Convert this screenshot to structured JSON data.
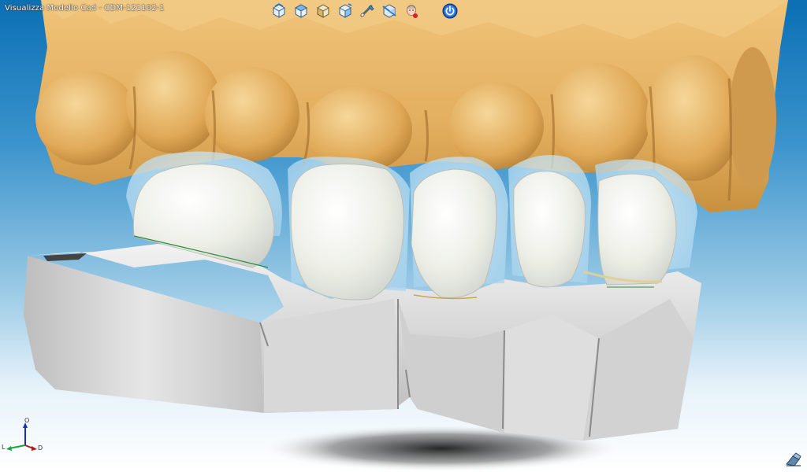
{
  "window": {
    "title": "Visualizza Modello Cad  - CDM-121102-1"
  },
  "toolbar": {
    "buttons": [
      {
        "icon": "view-front-icon"
      },
      {
        "icon": "view-top-icon"
      },
      {
        "icon": "view-left-icon"
      },
      {
        "icon": "view-right-icon"
      },
      {
        "icon": "measure-icon"
      },
      {
        "icon": "section-icon"
      },
      {
        "icon": "patient-icon"
      },
      {
        "icon": "power-icon"
      }
    ]
  },
  "axes": {
    "labels": {
      "up": "O",
      "left": "L",
      "right": "D"
    }
  },
  "colors": {
    "bg_top": "#0b6fb4",
    "bg_bottom": "#ffffff",
    "upper_model": "#e4b064",
    "lower_model": "#dcdcdc",
    "crowns": "#f2f2ea",
    "ghost": "#bfe0f2"
  }
}
